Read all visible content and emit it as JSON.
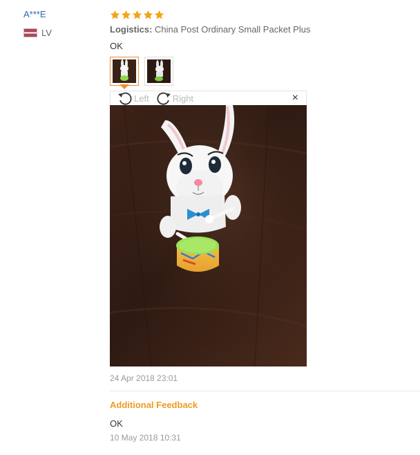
{
  "reviewer": {
    "name": "A***E",
    "country_code": "LV"
  },
  "review": {
    "rating": 5,
    "logistics_label": "Logistics:",
    "logistics_value": "China Post Ordinary Small Packet Plus",
    "text": "OK",
    "date": "24 Apr 2018 23:01",
    "photos_count": 2
  },
  "viewer": {
    "rotate_left_label": "Left",
    "rotate_right_label": "Right",
    "close_symbol": "×"
  },
  "additional_feedback": {
    "title": "Additional Feedback",
    "text": "OK",
    "date": "10 May 2018 10:31"
  },
  "colors": {
    "accent": "#f09a20",
    "star": "#f4a418",
    "link": "#2a6ab8",
    "active_border": "#ee8a3a"
  },
  "icons": {
    "star": "star-icon",
    "flag": "latvia-flag-icon",
    "rotate_left": "rotate-left-icon",
    "rotate_right": "rotate-right-icon",
    "close": "close-icon"
  }
}
